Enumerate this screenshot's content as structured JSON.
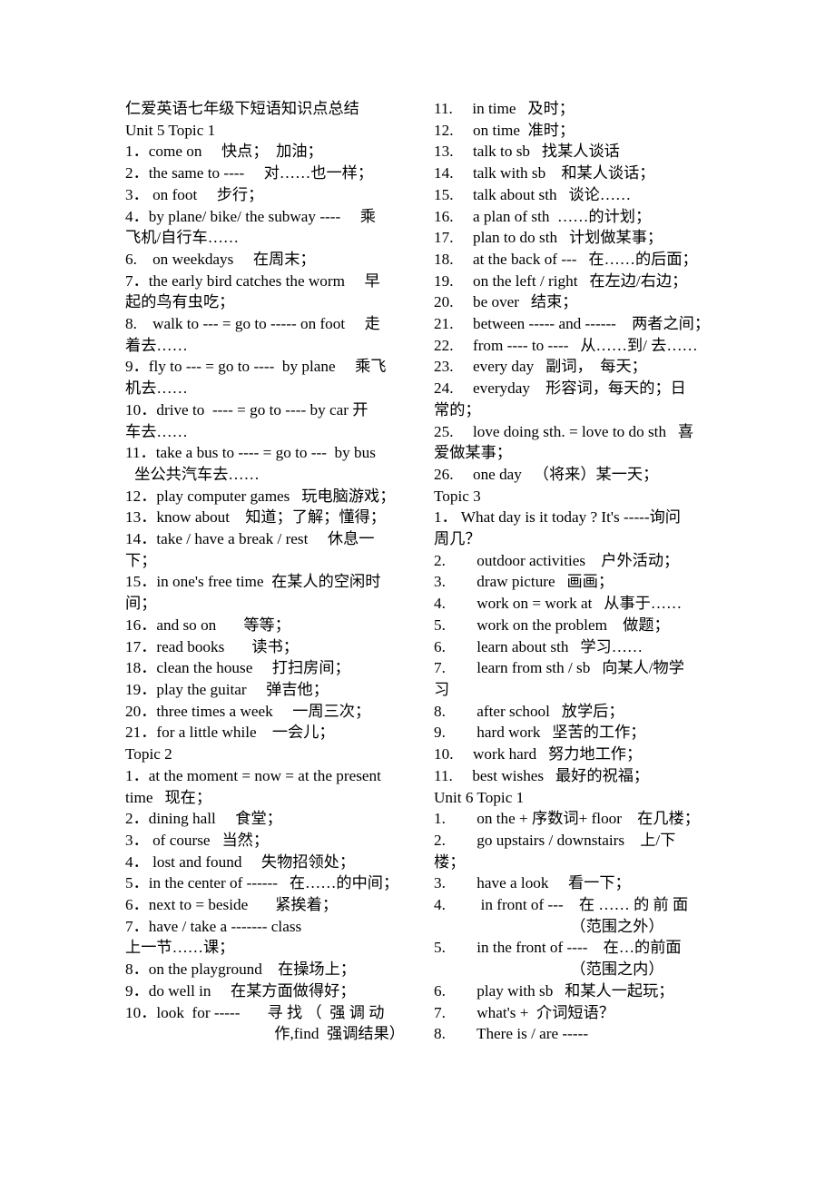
{
  "document": {
    "title": "仁爱英语七年级下短语知识点总结",
    "page_bg": "#ffffff",
    "text_color": "#000000"
  },
  "left_column": {
    "lines": [
      "仁爱英语七年级下短语知识点总结",
      "Unit 5 Topic 1",
      "1．come on     快点；  加油；",
      "2．the same to ----     对……也一样；",
      "3． on foot     步行；",
      "4．by plane/ bike/ the subway ----     乘",
      "飞机/自行车……",
      "6.    on weekdays     在周末；",
      "7．the early bird catches the worm     早",
      "起的鸟有虫吃；",
      "8.    walk to --- = go to ----- on foot     走",
      "着去……",
      "9．fly to --- = go to ----  by plane     乘飞",
      "机去……",
      "10．drive to  ---- = go to ---- by car 开",
      "车去……",
      "11．take a bus to ---- = go to ---  by bus",
      " 坐公共汽车去……",
      "12．play computer games   玩电脑游戏；",
      "13．know about    知道；了解；懂得；",
      "14．take / have a break / rest     休息一",
      "下；",
      "15．in one's free time  在某人的空闲时",
      "间；",
      "16．and so on       等等；",
      "17．read books       读书；",
      "18．clean the house     打扫房间；",
      "19．play the guitar     弹吉他；",
      "20．three times a week     一周三次；",
      "21．for a little while    一会儿；",
      "Topic 2",
      "1．at the moment = now = at the present",
      "time   现在；",
      "2．dining hall     食堂；",
      "3． of course   当然；",
      "4． lost and found     失物招领处；",
      "5．in the center of ------   在……的中间；",
      "6．next to = beside       紧挨着；",
      "7．have / take a ------- class",
      "上一节……课；",
      "8．on the playground    在操场上；",
      "9．do well in     在某方面做得好；",
      "10．look  for -----       寻 找 （  强 调 动",
      "作,find  强调结果）"
    ],
    "indent_lines": [
      17
    ],
    "right_align_lines": [
      43
    ]
  },
  "right_column": {
    "lines": [
      "11.     in time   及时；",
      "12.     on time  准时；",
      "13.     talk to sb   找某人谈话",
      "14.     talk with sb    和某人谈话；",
      "15.     talk about sth   谈论……",
      "16.     a plan of sth  ……的计划；",
      "17.     plan to do sth   计划做某事；",
      "18.     at the back of ---   在……的后面；",
      "19.     on the left / right   在左边/右边；",
      "20.     be over   结束；",
      "21.     between ----- and ------    两者之间；",
      "22.     from ---- to ----   从……到/ 去……",
      "23.     every day   副词，  每天；",
      "24.     everyday    形容词，每天的；日",
      "常的；",
      "25.     love doing sth. = love to do sth   喜",
      "爱做某事；",
      "26.     one day   （将来）某一天；",
      "Topic 3",
      "1． What day is it today ? It's -----询问",
      "周几？",
      "2.        outdoor activities    户外活动；",
      "3.        draw picture   画画；",
      "4.        work on = work at   从事于……",
      "5.        work on the problem    做题；",
      "6.        learn about sth   学习……",
      "7.        learn from sth / sb   向某人/物学",
      "习",
      "8.        after school   放学后；",
      "9.        hard work   坚苦的工作；",
      "10.     work hard   努力地工作；",
      "11.     best wishes   最好的祝福；",
      "Unit 6 Topic 1",
      "1.        on the + 序数词+ floor    在几楼；",
      "2.        go upstairs / downstairs    上/下",
      "楼；",
      "3.        have a look     看一下；",
      "4.         in front of ---    在 …… 的 前 面",
      "（范围之外）",
      "5.        in the front of ----    在…的前面",
      "（范围之内）",
      "6.        play with sb   和某人一起玩；",
      "7.        what's +  介词短语？",
      "8.        There is / are -----"
    ],
    "center_lines": [
      38,
      40
    ]
  }
}
